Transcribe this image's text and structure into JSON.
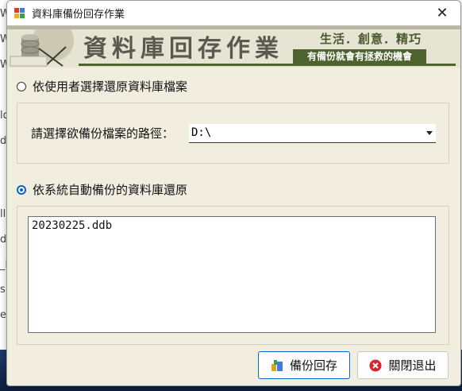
{
  "window": {
    "title": "資料庫備份回存作業",
    "close_glyph": "✕"
  },
  "banner": {
    "title": "資料庫回存作業",
    "slogan": "生活．創意．精巧",
    "subtitle": "有備份就會有拯救的機會"
  },
  "desktop_fragments": [
    "W",
    "W",
    "W",
    "ld",
    "d",
    "ll",
    "d",
    "_Li",
    "s.",
    "er"
  ],
  "options": {
    "manual": {
      "label": "依使用者選擇還原資料庫檔案",
      "checked": false
    },
    "auto": {
      "label": "依系統自動備份的資料庫還原",
      "checked": true
    }
  },
  "path": {
    "label": "請選擇欲備份檔案的路徑：",
    "value": "D:\\"
  },
  "backup_list": {
    "items": [
      "20230225.ddb"
    ]
  },
  "buttons": {
    "restore": {
      "label": "備份回存",
      "icon": "database-restore-icon"
    },
    "exit": {
      "label": "關閉退出",
      "icon": "close-circle-icon"
    }
  },
  "colors": {
    "accent": "#0a63c8",
    "window_bg": "#f1eee0",
    "banner_green": "#4e6230",
    "exit_red": "#d9232a"
  }
}
